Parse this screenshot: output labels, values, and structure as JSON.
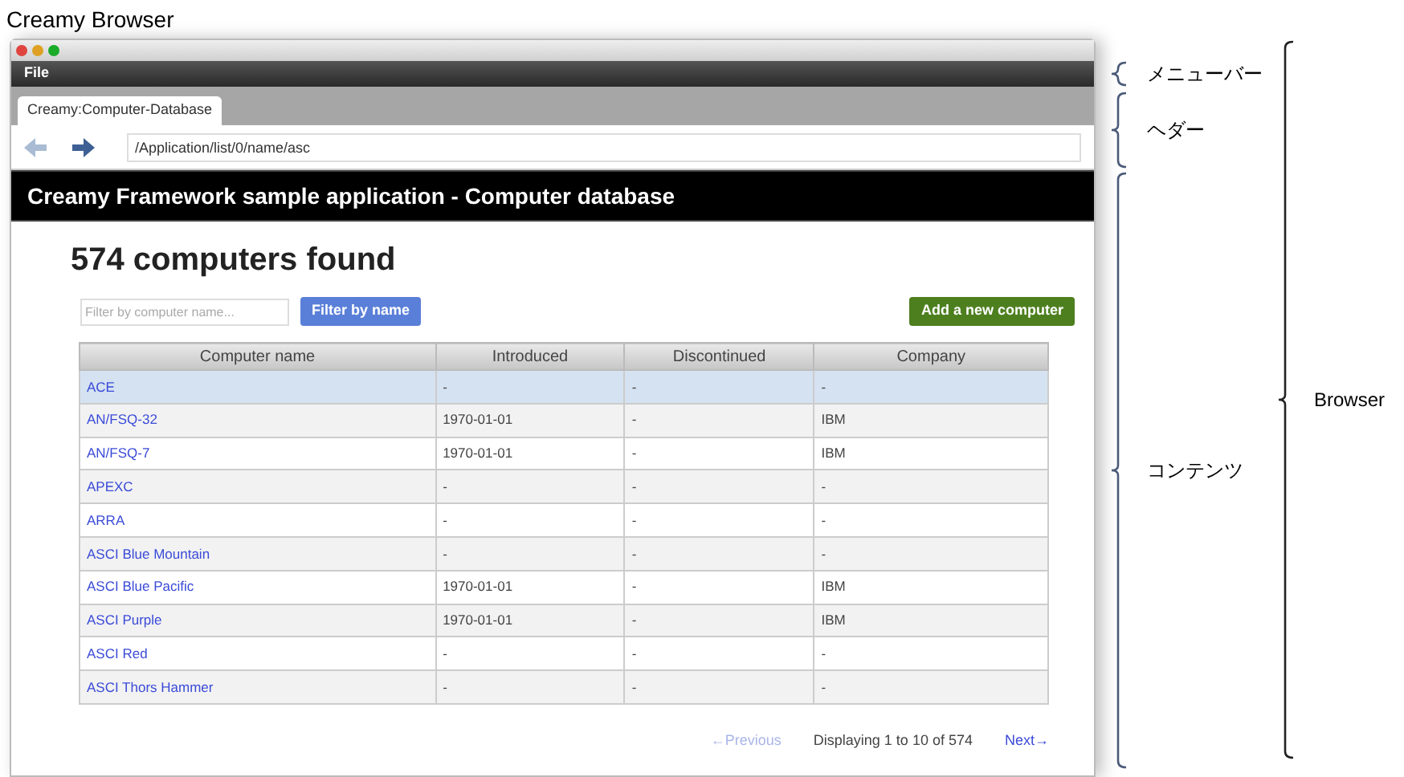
{
  "title": "Creamy Browser",
  "menu_bar": {
    "items": [
      "File"
    ]
  },
  "tabs": [
    {
      "label": "Creamy:Computer-Database",
      "selected": true
    }
  ],
  "address_bar": {
    "value": "/Application/list/0/name/asc"
  },
  "app_header": "Creamy Framework sample application - Computer database",
  "heading": "574 computers found",
  "filter": {
    "placeholder": "Filter by computer name...",
    "button": "Filter by name"
  },
  "add_button": "Add a new computer",
  "table": {
    "columns": [
      "Computer name",
      "Introduced",
      "Discontinued",
      "Company"
    ],
    "rows": [
      {
        "cells": [
          "ACE",
          "-",
          "-",
          "-"
        ],
        "selected": true
      },
      {
        "cells": [
          "AN/FSQ-32",
          "1970-01-01",
          "-",
          "IBM"
        ],
        "selected": false
      },
      {
        "cells": [
          "AN/FSQ-7",
          "1970-01-01",
          "-",
          "IBM"
        ],
        "selected": false
      },
      {
        "cells": [
          "APEXC",
          "-",
          "-",
          "-"
        ],
        "selected": false
      },
      {
        "cells": [
          "ARRA",
          "-",
          "-",
          "-"
        ],
        "selected": false
      },
      {
        "cells": [
          "ASCI Blue Mountain",
          "-",
          "-",
          "-"
        ],
        "selected": false
      },
      {
        "cells": [
          "ASCI Blue Pacific",
          "1970-01-01",
          "-",
          "IBM"
        ],
        "selected": false
      },
      {
        "cells": [
          "ASCI Purple",
          "1970-01-01",
          "-",
          "IBM"
        ],
        "selected": false
      },
      {
        "cells": [
          "ASCI Red",
          "-",
          "-",
          "-"
        ],
        "selected": false
      },
      {
        "cells": [
          "ASCI Thors Hammer",
          "-",
          "-",
          "-"
        ],
        "selected": false
      }
    ]
  },
  "pagination": {
    "previous": {
      "label": "←Previous",
      "disabled": true
    },
    "status": "Displaying 1 to 10 of 574",
    "next": {
      "label": "Next→",
      "disabled": false
    }
  },
  "annotations": [
    {
      "label": "メニューバー"
    },
    {
      "label": "ヘダー"
    },
    {
      "label": "コンテンツ"
    },
    {
      "label": "Browser"
    }
  ]
}
